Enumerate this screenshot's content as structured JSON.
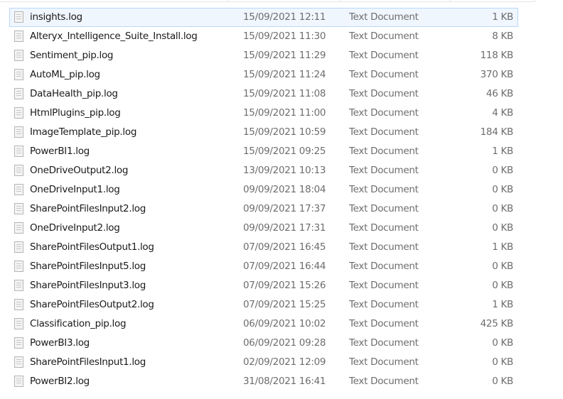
{
  "files": [
    {
      "name": "insights.log",
      "date": "15/09/2021 12:11",
      "type": "Text Document",
      "size": "1 KB"
    },
    {
      "name": "Alteryx_Intelligence_Suite_Install.log",
      "date": "15/09/2021 11:30",
      "type": "Text Document",
      "size": "8 KB"
    },
    {
      "name": "Sentiment_pip.log",
      "date": "15/09/2021 11:29",
      "type": "Text Document",
      "size": "118 KB"
    },
    {
      "name": "AutoML_pip.log",
      "date": "15/09/2021 11:24",
      "type": "Text Document",
      "size": "370 KB"
    },
    {
      "name": "DataHealth_pip.log",
      "date": "15/09/2021 11:08",
      "type": "Text Document",
      "size": "46 KB"
    },
    {
      "name": "HtmlPlugins_pip.log",
      "date": "15/09/2021 11:00",
      "type": "Text Document",
      "size": "4 KB"
    },
    {
      "name": "ImageTemplate_pip.log",
      "date": "15/09/2021 10:59",
      "type": "Text Document",
      "size": "184 KB"
    },
    {
      "name": "PowerBI1.log",
      "date": "15/09/2021 09:25",
      "type": "Text Document",
      "size": "1 KB"
    },
    {
      "name": "OneDriveOutput2.log",
      "date": "13/09/2021 10:13",
      "type": "Text Document",
      "size": "0 KB"
    },
    {
      "name": "OneDriveInput1.log",
      "date": "09/09/2021 18:04",
      "type": "Text Document",
      "size": "0 KB"
    },
    {
      "name": "SharePointFilesInput2.log",
      "date": "09/09/2021 17:37",
      "type": "Text Document",
      "size": "0 KB"
    },
    {
      "name": "OneDriveInput2.log",
      "date": "09/09/2021 17:31",
      "type": "Text Document",
      "size": "0 KB"
    },
    {
      "name": "SharePointFilesOutput1.log",
      "date": "07/09/2021 16:45",
      "type": "Text Document",
      "size": "1 KB"
    },
    {
      "name": "SharePointFilesInput5.log",
      "date": "07/09/2021 16:44",
      "type": "Text Document",
      "size": "0 KB"
    },
    {
      "name": "SharePointFilesInput3.log",
      "date": "07/09/2021 15:26",
      "type": "Text Document",
      "size": "0 KB"
    },
    {
      "name": "SharePointFilesOutput2.log",
      "date": "07/09/2021 15:25",
      "type": "Text Document",
      "size": "1 KB"
    },
    {
      "name": "Classification_pip.log",
      "date": "06/09/2021 10:02",
      "type": "Text Document",
      "size": "425 KB"
    },
    {
      "name": "PowerBI3.log",
      "date": "06/09/2021 09:28",
      "type": "Text Document",
      "size": "0 KB"
    },
    {
      "name": "SharePointFilesInput1.log",
      "date": "02/09/2021 12:09",
      "type": "Text Document",
      "size": "0 KB"
    },
    {
      "name": "PowerBI2.log",
      "date": "31/08/2021 16:41",
      "type": "Text Document",
      "size": "0 KB"
    }
  ],
  "selected_index": 0
}
